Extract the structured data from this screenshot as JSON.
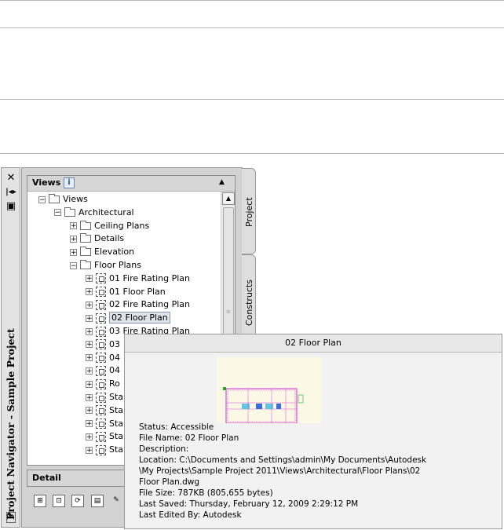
{
  "palette": {
    "vertical_title": "Project Navigator - Sample Project",
    "titlebar_icons": [
      "close-icon",
      "auto-hide-icon",
      "properties-icon"
    ],
    "views_panel": {
      "title": "Views",
      "tree": [
        {
          "label": "Views",
          "level": 0,
          "expander": "−",
          "icon": "open-folder-icon"
        },
        {
          "label": "Architectural",
          "level": 1,
          "expander": "−",
          "icon": "open-folder-icon"
        },
        {
          "label": "Ceiling Plans",
          "level": 2,
          "expander": "+",
          "icon": "folder-icon"
        },
        {
          "label": "Details",
          "level": 2,
          "expander": "+",
          "icon": "folder-icon"
        },
        {
          "label": "Elevation",
          "level": 2,
          "expander": "+",
          "icon": "folder-icon"
        },
        {
          "label": "Floor Plans",
          "level": 2,
          "expander": "−",
          "icon": "open-folder-icon"
        },
        {
          "label": "01 Fire Rating Plan",
          "level": 3,
          "expander": "+",
          "icon": "view-icon"
        },
        {
          "label": "01 Floor Plan",
          "level": 3,
          "expander": "+",
          "icon": "view-icon"
        },
        {
          "label": "02 Fire Rating Plan",
          "level": 3,
          "expander": "+",
          "icon": "view-icon"
        },
        {
          "label": "02 Floor Plan",
          "level": 3,
          "expander": "+",
          "icon": "view-icon",
          "selected": true
        },
        {
          "label": "03 Fire Rating Plan",
          "level": 3,
          "expander": "+",
          "icon": "view-icon"
        },
        {
          "label": "03",
          "level": 3,
          "expander": "+",
          "icon": "view-icon"
        },
        {
          "label": "04",
          "level": 3,
          "expander": "+",
          "icon": "view-icon"
        },
        {
          "label": "04",
          "level": 3,
          "expander": "+",
          "icon": "view-icon"
        },
        {
          "label": "Ro",
          "level": 3,
          "expander": "+",
          "icon": "view-icon"
        },
        {
          "label": "Sta",
          "level": 3,
          "expander": "+",
          "icon": "view-icon"
        },
        {
          "label": "Sta",
          "level": 3,
          "expander": "+",
          "icon": "view-icon"
        },
        {
          "label": "Sta",
          "level": 3,
          "expander": "+",
          "icon": "view-icon"
        },
        {
          "label": "Sta",
          "level": 3,
          "expander": "+",
          "icon": "view-icon"
        },
        {
          "label": "Sta",
          "level": 3,
          "expander": "+",
          "icon": "view-icon"
        }
      ]
    },
    "detail_panel": {
      "title": "Detail"
    },
    "toolbar_icons": [
      "add-view-icon",
      "add-section-icon",
      "regenerate-icon",
      "clipboard-icon",
      "edit-icon"
    ],
    "tabs": [
      "Project",
      "Constructs"
    ]
  },
  "tooltip": {
    "title": "02 Floor Plan",
    "lines": [
      "Status: Accessible",
      "File Name: 02 Floor Plan",
      "Description:",
      "Location: C:\\Documents and Settings\\admin\\My Documents\\Autodesk",
      "\\My Projects\\Sample Project 2011\\Views\\Architectural\\Floor Plans\\02",
      "Floor Plan.dwg",
      "File Size: 787KB (805,655 bytes)",
      "Last Saved: Thursday, February 12, 2009  2:29:12 PM",
      "Last Edited By: Autodesk"
    ]
  },
  "colors": {
    "accent_thumbnail": "#d64fd6",
    "thumbnail_bg": "#fbf8e6"
  }
}
